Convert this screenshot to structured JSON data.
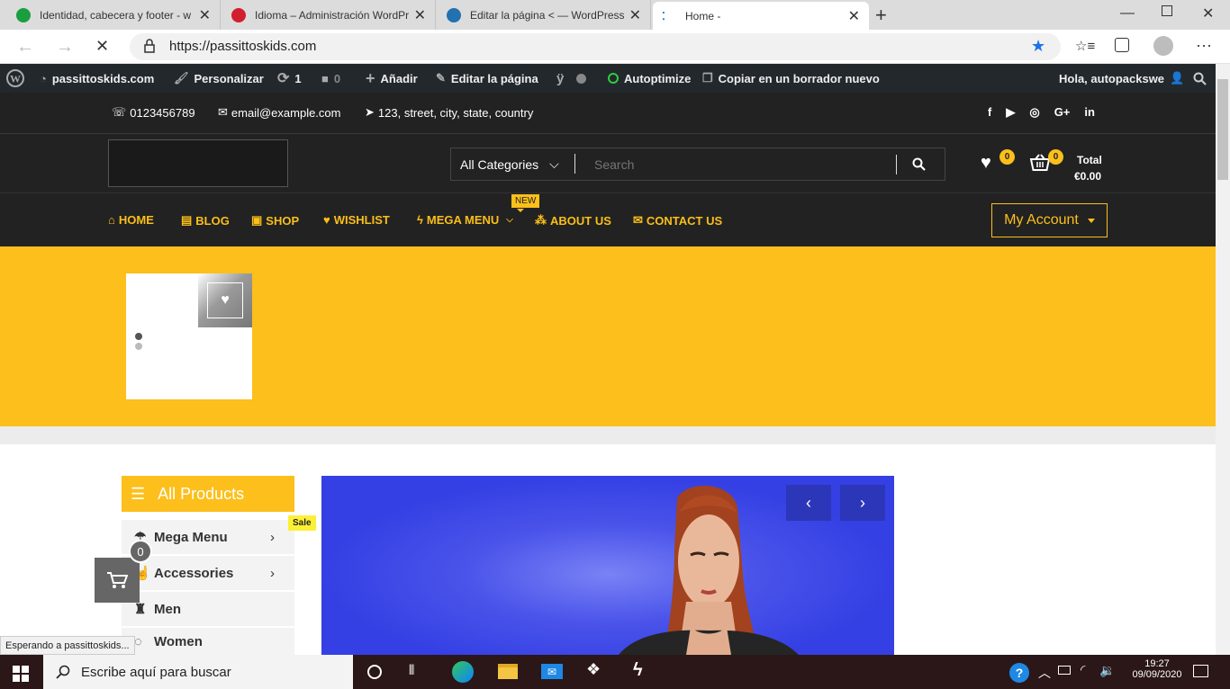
{
  "browser": {
    "tabs": [
      {
        "title": "Identidad, cabecera y footer - w",
        "icon_color": "#1a9e3f"
      },
      {
        "title": "Idioma – Administración WordPr",
        "icon_color": "#d11f2f"
      },
      {
        "title": "Editar la página < — WordPress",
        "icon_color": "#2271b1"
      },
      {
        "title": "Home -",
        "icon_color": "#1a73e8"
      }
    ],
    "url": "https://passittoskids.com",
    "status_text": "Esperando a passittoskids..."
  },
  "wp_admin": {
    "site": "passittoskids.com",
    "customize": "Personalizar",
    "updates": "1",
    "comments": "0",
    "add": "Añadir",
    "edit": "Editar la página",
    "autoptimize": "Autoptimize",
    "draft": "Copiar en un borrador nuevo",
    "greeting": "Hola, autopackswe"
  },
  "topinfo": {
    "phone": "0123456789",
    "email": "email@example.com",
    "address": "123, street, city, state, country"
  },
  "header": {
    "category": "All Categories",
    "search_placeholder": "Search",
    "wishlist_count": "0",
    "cart_count": "0",
    "total_label": "Total",
    "total_value": "€0.00"
  },
  "nav": {
    "home": "HOME",
    "blog": "BLOG",
    "shop": "SHOP",
    "wishlist": "WISHLIST",
    "mega": "MEGA MENU",
    "new_badge": "NEW",
    "about": "ABOUT US",
    "contact": "CONTACT US",
    "account": "My Account"
  },
  "sidebar": {
    "title": "All Products",
    "items": [
      {
        "label": "Mega Menu",
        "badge": "Sale"
      },
      {
        "label": "Accessories"
      },
      {
        "label": "Men"
      },
      {
        "label": "Women"
      }
    ]
  },
  "floating_cart": {
    "count": "0"
  },
  "taskbar": {
    "search": "Escribe aquí para buscar",
    "time": "19:27",
    "date": "09/09/2020"
  },
  "colors": {
    "accent": "#fcbf1b",
    "dark": "#222222",
    "slider_bg": "#3a46e6"
  }
}
